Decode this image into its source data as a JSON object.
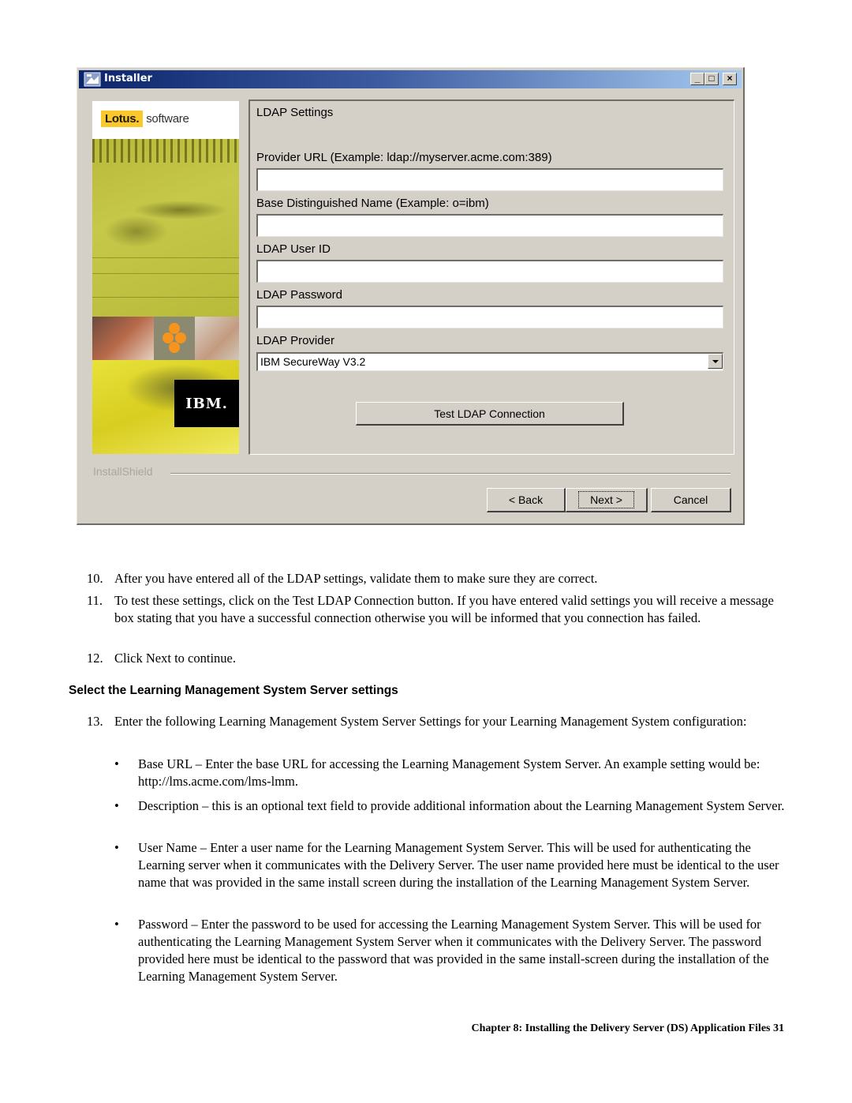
{
  "window": {
    "title": "Installer",
    "controls": {
      "minimize": "_",
      "maximize": "□",
      "close": "×"
    },
    "branding": {
      "lotus": "Lotus.",
      "software": "software",
      "ibm": "IBM."
    },
    "panel_title": "LDAP Settings",
    "fields": [
      {
        "label": "Provider URL (Example: ldap://myserver.acme.com:389)",
        "value": ""
      },
      {
        "label": "Base Distinguished Name (Example: o=ibm)",
        "value": ""
      },
      {
        "label": "LDAP User ID",
        "value": ""
      },
      {
        "label": "LDAP Password",
        "value": ""
      }
    ],
    "provider": {
      "label": "LDAP Provider",
      "selected": "IBM SecureWay V3.2"
    },
    "test_button": "Test LDAP Connection",
    "installshield_label": "InstallShield",
    "buttons": {
      "back": "< Back",
      "next": "Next >",
      "cancel": "Cancel"
    }
  },
  "steps": [
    {
      "num": "10.",
      "text": "After you have entered all of the LDAP settings, validate them to make sure they are correct."
    },
    {
      "num": "11.",
      "text": "To test these settings, click on the Test LDAP Connection button. If you have entered valid settings you will receive a message box stating that you have a successful connection otherwise you will be informed that you connection has failed."
    },
    {
      "num": "12.",
      "text": "Click Next to continue."
    }
  ],
  "section_heading": "Select the Learning Management System Server settings",
  "step13": {
    "num": "13.",
    "text": "Enter the following Learning Management System Server Settings for your Learning Management System configuration:"
  },
  "bullets": [
    {
      "text": "Base URL – Enter the base URL for accessing the Learning Management System Server. An example setting would be: http://lms.acme.com/lms-lmm."
    },
    {
      "text": "Description – this is an optional text field to provide additional information about the Learning Management System Server."
    },
    {
      "text": "User Name – Enter a user name for the Learning Management System Server. This will be used for authenticating the Learning server when it communicates with the Delivery Server. The user name provided here must be identical to the user name that was provided in the same install screen during the installation of the Learning Management System Server."
    },
    {
      "text": "Password – Enter the password to be used for accessing the Learning Management System Server. This will be used for authenticating the Learning Management System Server when it communicates with the Delivery Server. The password provided here must be identical to the password that was provided in the same install-screen during the installation of the Learning Management System Server."
    }
  ],
  "bullet_glyph": "•",
  "footer": "Chapter 8: Installing the Delivery Server (DS) Application Files 31"
}
